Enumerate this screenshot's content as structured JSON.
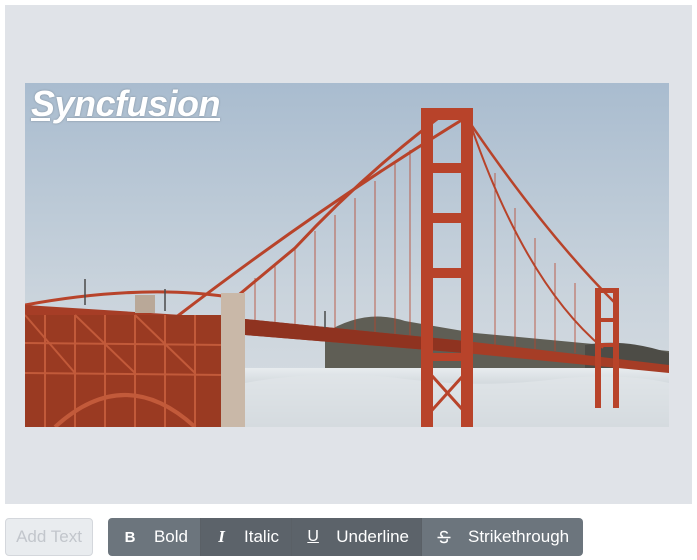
{
  "canvas": {
    "overlay_text": "Syncfusion",
    "image_alt": "Golden Gate Bridge photo"
  },
  "toolbar": {
    "add_text_label": "Add Text",
    "format_buttons": [
      {
        "label": "Bold",
        "icon": "bold-icon",
        "glyph": "B"
      },
      {
        "label": "Italic",
        "icon": "italic-icon",
        "glyph": "I"
      },
      {
        "label": "Underline",
        "icon": "underline-icon",
        "glyph": "U"
      },
      {
        "label": "Strikethrough",
        "icon": "strikethrough-icon",
        "glyph": ""
      }
    ]
  },
  "colors": {
    "canvas_bg": "#e0e3e8",
    "button_group_bg": "#6c757d",
    "active_button_bg": "#5c636a",
    "bridge_red": "#b8432a"
  }
}
